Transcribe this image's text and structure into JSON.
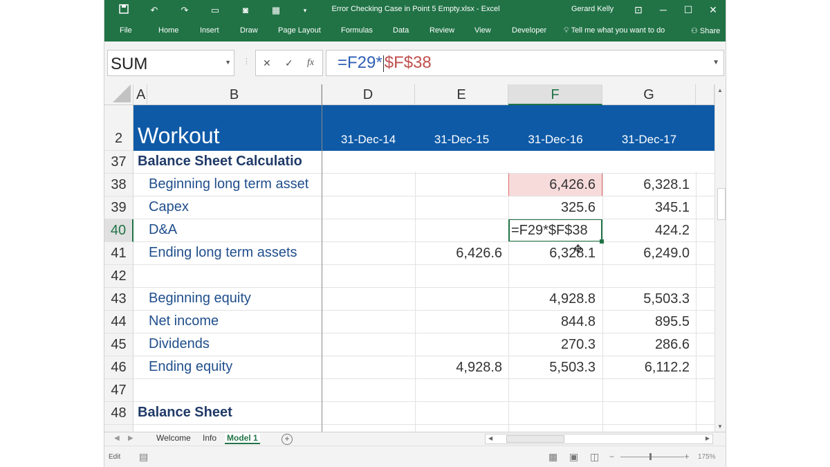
{
  "window": {
    "title": "Error Checking Case in Point 5 Empty.xlsx  -  Excel",
    "user": "Gerard Kelly",
    "accent_color": "#217346"
  },
  "quick_access_icons": [
    "save-icon",
    "undo-icon",
    "redo-icon",
    "screenshot-icon",
    "camera-icon",
    "calculator-icon",
    "customize-toolbar-icon"
  ],
  "ribbon_tabs": [
    "File",
    "Home",
    "Insert",
    "Draw",
    "Page Layout",
    "Formulas",
    "Data",
    "Review",
    "View",
    "Developer"
  ],
  "tell_me": "Tell me what you want to do",
  "share": "Share",
  "formula_bar": {
    "name_box": "SUM",
    "cancel": "✕",
    "enter": "✓",
    "fx": "fx",
    "formula_part1": "=F29*",
    "formula_part2": "$F$38",
    "part1_color": "#2e5fb5",
    "part2_color": "#c0504d"
  },
  "columns": [
    "A",
    "B",
    "D",
    "E",
    "F",
    "G"
  ],
  "selected_column": "F",
  "header_band": {
    "row_number": "2",
    "title": "Workout",
    "dates": [
      "31-Dec-14",
      "31-Dec-15",
      "31-Dec-16",
      "31-Dec-17"
    ],
    "fill_color": "#0e5aa7"
  },
  "rows": [
    {
      "num": "37",
      "label": "Balance Sheet Calculatio",
      "bold": true,
      "D": "",
      "E": "",
      "F": "",
      "G": ""
    },
    {
      "num": "38",
      "label": "Beginning long term asset",
      "bold": false,
      "D": "",
      "E": "",
      "F": "6,426.6",
      "G": "6,328.1"
    },
    {
      "num": "39",
      "label": "Capex",
      "bold": false,
      "D": "",
      "E": "",
      "F": "325.6",
      "G": "345.1"
    },
    {
      "num": "40",
      "label": "D&A",
      "bold": false,
      "D": "",
      "E": "",
      "F": "",
      "G": "424.2"
    },
    {
      "num": "41",
      "label": "Ending long term assets",
      "bold": false,
      "D": "",
      "E": "6,426.6",
      "F": "6,328.1",
      "G": "6,249.0"
    },
    {
      "num": "42",
      "label": "",
      "bold": false,
      "D": "",
      "E": "",
      "F": "",
      "G": ""
    },
    {
      "num": "43",
      "label": "Beginning equity",
      "bold": false,
      "D": "",
      "E": "",
      "F": "4,928.8",
      "G": "5,503.3"
    },
    {
      "num": "44",
      "label": "Net income",
      "bold": false,
      "D": "",
      "E": "",
      "F": "844.8",
      "G": "895.5"
    },
    {
      "num": "45",
      "label": "Dividends",
      "bold": false,
      "D": "",
      "E": "",
      "F": "270.3",
      "G": "286.6"
    },
    {
      "num": "46",
      "label": "Ending equity",
      "bold": false,
      "D": "",
      "E": "4,928.8",
      "F": "5,503.3",
      "G": "6,112.2"
    },
    {
      "num": "47",
      "label": "",
      "bold": false,
      "D": "",
      "E": "",
      "F": "",
      "G": ""
    },
    {
      "num": "48",
      "label": "Balance Sheet",
      "bold": true,
      "D": "",
      "E": "",
      "F": "",
      "G": ""
    }
  ],
  "active_cell": {
    "ref": "F40",
    "content": "=F29*$F$38"
  },
  "highlighted_cell": {
    "ref": "F38",
    "fill": "#f7dbdb",
    "border": "#e06666"
  },
  "sheet_tabs": [
    "Welcome",
    "Info",
    "Model 1"
  ],
  "active_sheet": "Model 1",
  "status": {
    "mode": "Edit",
    "zoom": "175%"
  }
}
